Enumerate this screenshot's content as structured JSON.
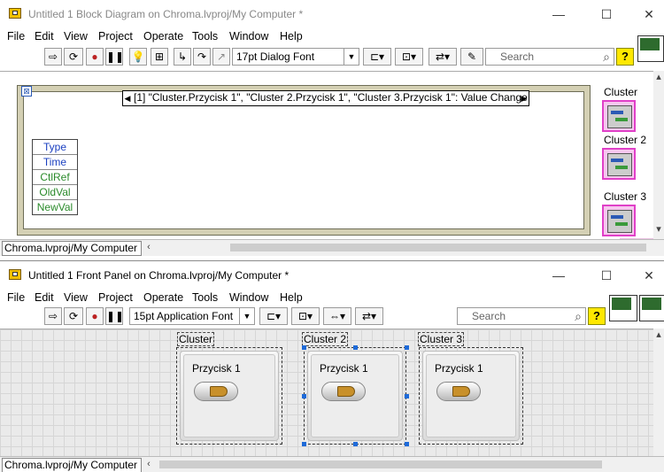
{
  "block_diagram": {
    "title": "Untitled 1 Block Diagram on Chroma.lvproj/My Computer *",
    "window_buttons": {
      "minimize": "—",
      "maximize": "☐",
      "close": "✕"
    },
    "menu": [
      "File",
      "Edit",
      "View",
      "Project",
      "Operate",
      "Tools",
      "Window",
      "Help"
    ],
    "toolbar": {
      "font": "17pt Dialog Font",
      "search_placeholder": "Search",
      "help_label": "?"
    },
    "event_structure": {
      "case_label": "[1] \"Cluster.Przycisk 1\", \"Cluster 2.Przycisk 1\", \"Cluster 3.Przycisk 1\": Value Change",
      "event_terminal": "⊠",
      "data_node": [
        "Type",
        "Time",
        "CtlRef",
        "OldVal",
        "NewVal"
      ]
    },
    "terminals": [
      "Cluster",
      "Cluster 2",
      "Cluster 3"
    ],
    "status_path": "Chroma.lvproj/My Computer"
  },
  "front_panel": {
    "title": "Untitled 1 Front Panel on Chroma.lvproj/My Computer *",
    "window_buttons": {
      "minimize": "—",
      "maximize": "☐",
      "close": "✕"
    },
    "menu": [
      "File",
      "Edit",
      "View",
      "Project",
      "Operate",
      "Tools",
      "Window",
      "Help"
    ],
    "toolbar": {
      "font": "15pt Application Font",
      "search_placeholder": "Search",
      "help_label": "?"
    },
    "clusters": [
      {
        "label": "Cluster",
        "button_label": "Przycisk 1",
        "selected": false
      },
      {
        "label": "Cluster 2",
        "button_label": "Przycisk 1",
        "selected": true
      },
      {
        "label": "Cluster 3",
        "button_label": "Przycisk 1",
        "selected": false
      }
    ],
    "status_path": "Chroma.lvproj/My Computer"
  },
  "colors": {
    "structure_border": "#d4d0b4",
    "terminal_pink": "#e040c8",
    "help_yellow": "#ffe800",
    "selection_blue": "#1e6ad8",
    "data_node_text_blue": "#1a3fc0",
    "data_node_text_green": "#2a8a2a"
  }
}
